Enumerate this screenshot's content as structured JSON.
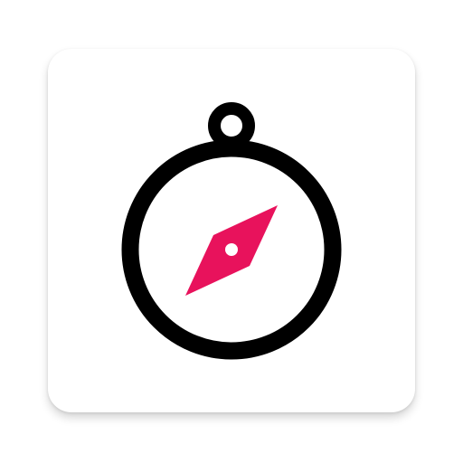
{
  "app_icon": {
    "background_color": "#ffffff",
    "glyph": "compass-icon",
    "ring_color": "#000000",
    "needle_color": "#e8125c",
    "pivot_color": "#ffffff"
  }
}
